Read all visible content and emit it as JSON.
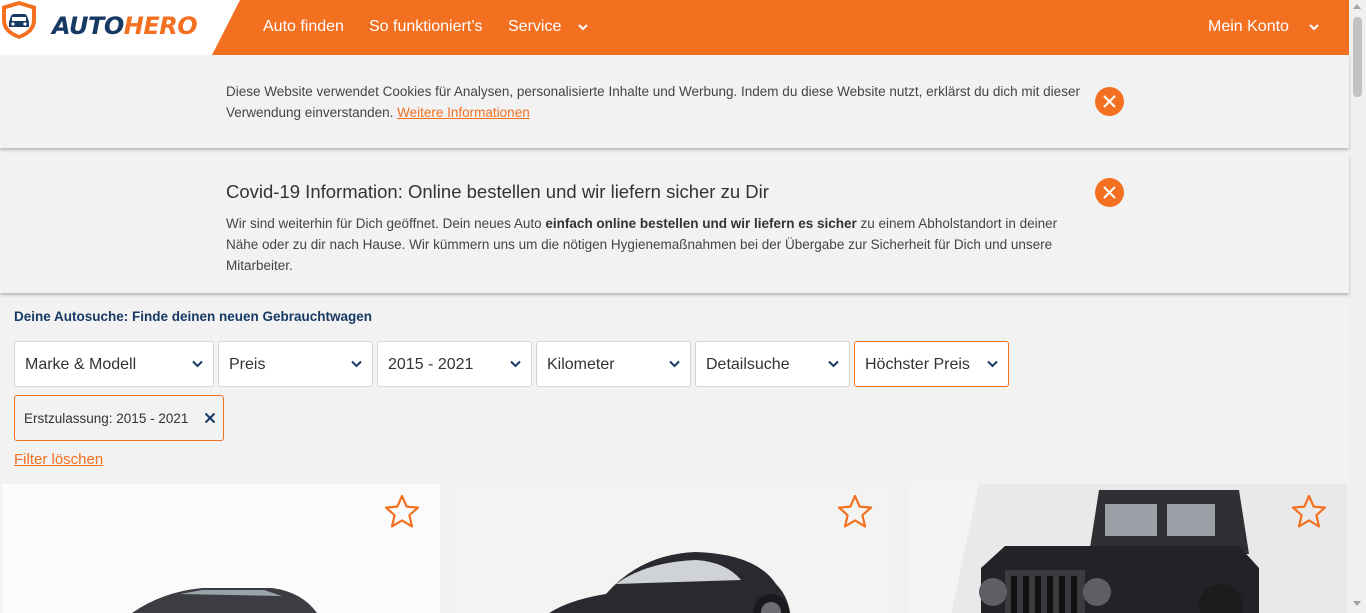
{
  "brand": {
    "part1": "AUTO",
    "part2": "HERO",
    "accent": "#f37021",
    "navy": "#173a64"
  },
  "nav": {
    "items": [
      "Auto finden",
      "So funktioniert’s",
      "Service"
    ],
    "account": "Mein Konto"
  },
  "cookie": {
    "text": "Diese Website verwendet Cookies für Analysen, personalisierte Inhalte und Werbung. Indem du diese Website nutzt, erklärst du dich mit dieser Verwendung einverstanden.",
    "link": "Weitere Informationen"
  },
  "covid": {
    "title": "Covid-19 Information: Online bestellen und wir liefern sicher zu Dir",
    "body_pre": "Wir sind weiterhin für Dich geöffnet. Dein neues Auto ",
    "body_bold": "einfach online bestellen und wir liefern es sicher",
    "body_post": " zu einem Abholstandort in deiner Nähe oder zu dir nach Hause. Wir kümmern uns um die nötigen Hygienemaßnahmen bei der Übergabe zur Sicherheit für Dich und unsere Mitarbeiter."
  },
  "search": {
    "heading": "Deine Autosuche: Finde deinen neuen Gebrauchtwagen",
    "filters": [
      "Marke & Modell",
      "Preis",
      "2015 - 2021",
      "Kilometer",
      "Detailsuche",
      "Höchster Preis"
    ],
    "chip": "Erstzulassung: 2015 - 2021",
    "clear": "Filter löschen"
  },
  "icons": {
    "close": "close-icon",
    "chevron": "chevron-down-icon",
    "favorite": "star-icon"
  }
}
